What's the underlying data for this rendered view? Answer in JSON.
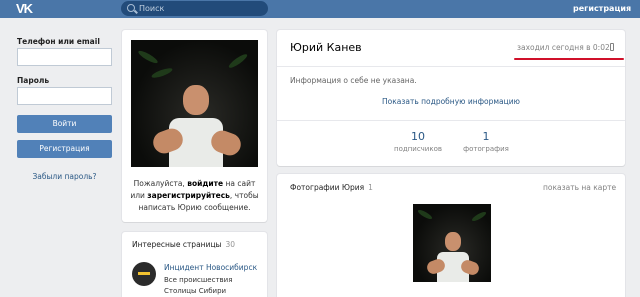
{
  "header": {
    "logo": "VK",
    "search_placeholder": "Поиск",
    "register_link": "регистрация"
  },
  "login": {
    "phone_label": "Телефон или email",
    "password_label": "Пароль",
    "login_button": "Войти",
    "register_button": "Регистрация",
    "forgot_link": "Забыли пароль?"
  },
  "photo_card": {
    "prompt_1": "Пожалуйста, ",
    "prompt_login": "войдите",
    "prompt_2": " на сайт или ",
    "prompt_register": "зарегистрируйтесь",
    "prompt_3": ", чтобы написать Юрию сообщение."
  },
  "interesting": {
    "title": "Интересные страницы",
    "count": "30",
    "items": [
      {
        "name": "Инцидент Новосибирск",
        "subtitle": "Все происшествия Столицы Сибири"
      }
    ]
  },
  "profile": {
    "name": "Юрий Канев",
    "last_seen": "заходил сегодня в 0:02",
    "about": "Информация о себе не указана.",
    "show_more": "Показать подробную информацию",
    "stats": [
      {
        "value": "10",
        "label": "подписчиков"
      },
      {
        "value": "1",
        "label": "фотография"
      }
    ],
    "accent_color": "#d0102a"
  },
  "photos": {
    "title": "Фотографии Юрия",
    "count": "1",
    "map_link": "показать на карте"
  }
}
